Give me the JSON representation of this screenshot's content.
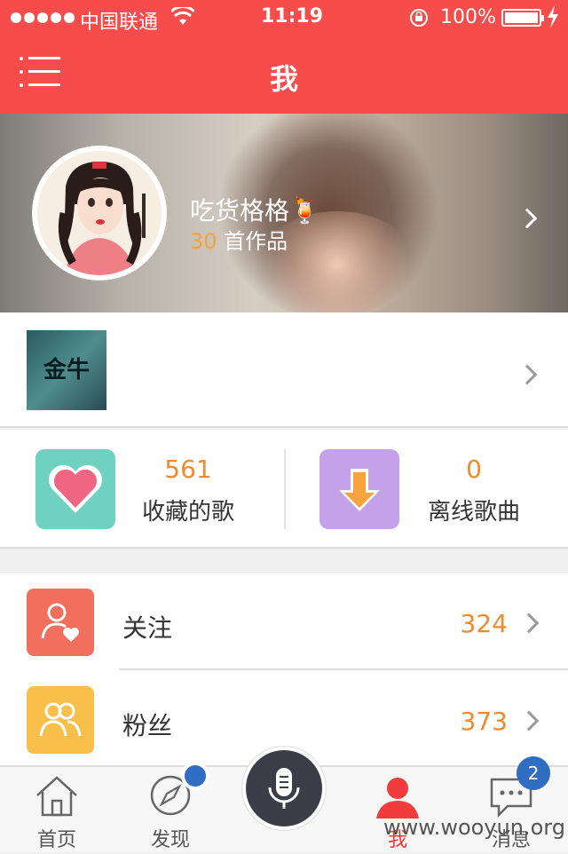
{
  "status_bar": {
    "carrier": "中国联通",
    "time": "11:19",
    "battery": "100%",
    "signal_icon": "signal-dots-icon",
    "wifi_icon": "wifi-icon",
    "lock_icon": "rotation-lock-icon",
    "charge_icon": "charging-bolt-icon"
  },
  "nav": {
    "title": "我",
    "menu_icon": "menu-list-icon"
  },
  "profile": {
    "name": "吃货格格🍹",
    "works_count": "30",
    "works_label": " 首作品"
  },
  "album": {
    "cover_text": "金牛"
  },
  "stats": [
    {
      "value": "561",
      "label": "收藏的歌",
      "icon": "heart-icon",
      "color": "#6fd2c0"
    },
    {
      "value": "0",
      "label": "离线歌曲",
      "icon": "download-arrow-icon",
      "color": "#c5a1e9"
    }
  ],
  "list": [
    {
      "label": "关注",
      "count": "324",
      "icon": "follow-user-icon",
      "color": "#f36f5d"
    },
    {
      "label": "粉丝",
      "count": "373",
      "icon": "fans-users-icon",
      "color": "#f8c04a"
    }
  ],
  "tabs": [
    {
      "label": "首页",
      "icon": "home-icon"
    },
    {
      "label": "发现",
      "icon": "compass-icon"
    },
    {
      "label": "",
      "icon": "microphone-icon"
    },
    {
      "label": "我",
      "icon": "user-icon"
    },
    {
      "label": "消息",
      "icon": "chat-bubble-icon"
    }
  ],
  "badges": {
    "messages": "2"
  },
  "watermark": "www.wooyun.org",
  "colors": {
    "accent": "#f74c4c",
    "number": "#f08a2a"
  }
}
